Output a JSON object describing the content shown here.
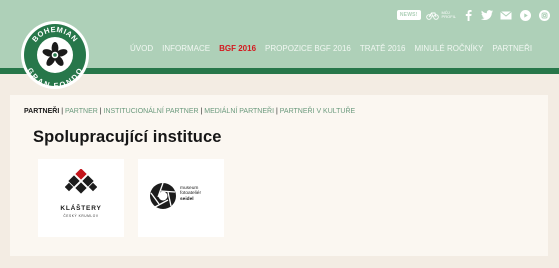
{
  "header": {
    "news_badge": "NEWS!",
    "profile_label": "MŮJ\nPROFIL",
    "social_icons": [
      "bike-icon",
      "facebook-icon",
      "twitter-icon",
      "mail-icon",
      "play-icon",
      "instagram-icon"
    ],
    "logo": {
      "name": "bohemian-gran-fondo-logo",
      "text_top": "BOHEMIAN",
      "text_bottom": "GRAN FONDO"
    },
    "nav": [
      {
        "label": "ÚVOD",
        "active": false
      },
      {
        "label": "INFORMACE",
        "active": false
      },
      {
        "label": "BGF 2016",
        "active": true
      },
      {
        "label": "PROPOZICE BGF 2016",
        "active": false
      },
      {
        "label": "TRATĚ 2016",
        "active": false
      },
      {
        "label": "MINULÉ ROČNÍKY",
        "active": false
      },
      {
        "label": "PARTNEŘI",
        "active": false
      }
    ]
  },
  "breadcrumb": {
    "current": "PARTNEŘI",
    "items": [
      "PARTNER",
      "INSTITUCIONÁLNÍ PARTNER",
      "MEDIÁLNÍ PARTNEŘI",
      "PARTNEŘI V KULTUŘE"
    ]
  },
  "page_title": "Spolupracující instituce",
  "partners": [
    {
      "name": "KLÁŠTERY",
      "subtitle": "ČESKÝ KRUMLOV"
    },
    {
      "line1": "museum",
      "line2": "fotoateliér",
      "line3": "seidel"
    }
  ],
  "colors": {
    "header_green": "#aed0b8",
    "header_stripe": "#27774a",
    "active_nav": "#d4191f",
    "page_background": "#f3ece3",
    "content_background": "#fbf7f1"
  }
}
